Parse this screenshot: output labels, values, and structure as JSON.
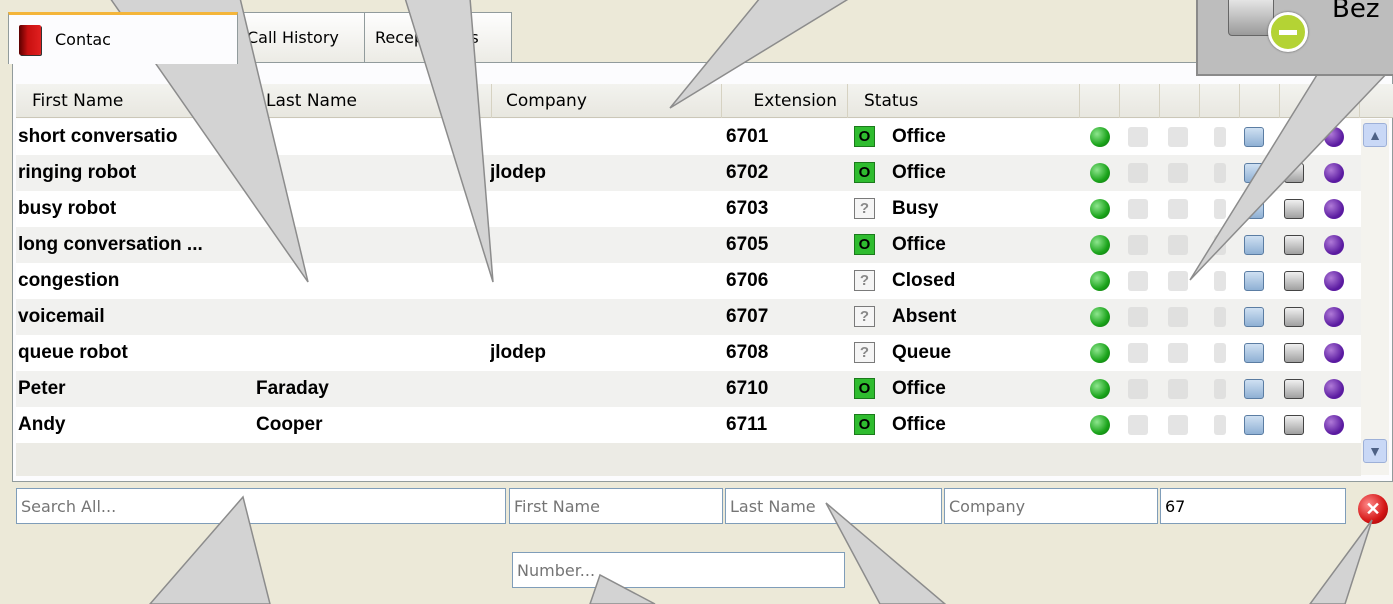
{
  "tabs": [
    {
      "label": "Contacts",
      "visible_label": "Contac"
    },
    {
      "label": "Call History"
    },
    {
      "label": "Recep",
      "suffix": "ts"
    }
  ],
  "columns": [
    "First Name",
    "Last Name",
    "Company",
    "Extension",
    "Status"
  ],
  "rows": [
    {
      "first": "short conversatio",
      "last": "",
      "company": "",
      "ext": "6701",
      "status": "Office",
      "status_icon": "O"
    },
    {
      "first": "ringing robot",
      "last": "",
      "company": "jlodep",
      "ext": "6702",
      "status": "Office",
      "status_icon": "O"
    },
    {
      "first": "busy robot",
      "last": "",
      "company": "",
      "ext": "6703",
      "status": "Busy",
      "status_icon": "?"
    },
    {
      "first": "long conversation ...",
      "last": "",
      "company": "",
      "ext": "6705",
      "status": "Office",
      "status_icon": "O"
    },
    {
      "first": "congestion",
      "last": "",
      "company": "",
      "ext": "6706",
      "status": "Closed",
      "status_icon": "?"
    },
    {
      "first": "voicemail",
      "last": "",
      "company": "",
      "ext": "6707",
      "status": "Absent",
      "status_icon": "?"
    },
    {
      "first": "queue robot",
      "last": "",
      "company": "jlodep",
      "ext": "6708",
      "status": "Queue",
      "status_icon": "?"
    },
    {
      "first": "Peter",
      "last": "Faraday",
      "company": "",
      "ext": "6710",
      "status": "Office",
      "status_icon": "O"
    },
    {
      "first": "Andy",
      "last": "Cooper",
      "company": "",
      "ext": "6711",
      "status": "Office",
      "status_icon": "O"
    }
  ],
  "search": {
    "all_placeholder": "Search All...",
    "first_placeholder": "First Name",
    "last_placeholder": "Last Name",
    "company_placeholder": "Company",
    "extension_value": "67",
    "number_placeholder": "Number..."
  },
  "callout_text": "Bez",
  "icons": {
    "row_actions": [
      "call-icon",
      "phone-icon",
      "phone-icon",
      "mobile-icon",
      "mail-icon",
      "note-icon",
      "balloon-icon"
    ],
    "clear": "clear-search-icon",
    "status_badge": "minus-icon"
  },
  "colors": {
    "office": "#2fbc2f",
    "tab_accent": "#f4b53a",
    "clear": "#d41515"
  }
}
